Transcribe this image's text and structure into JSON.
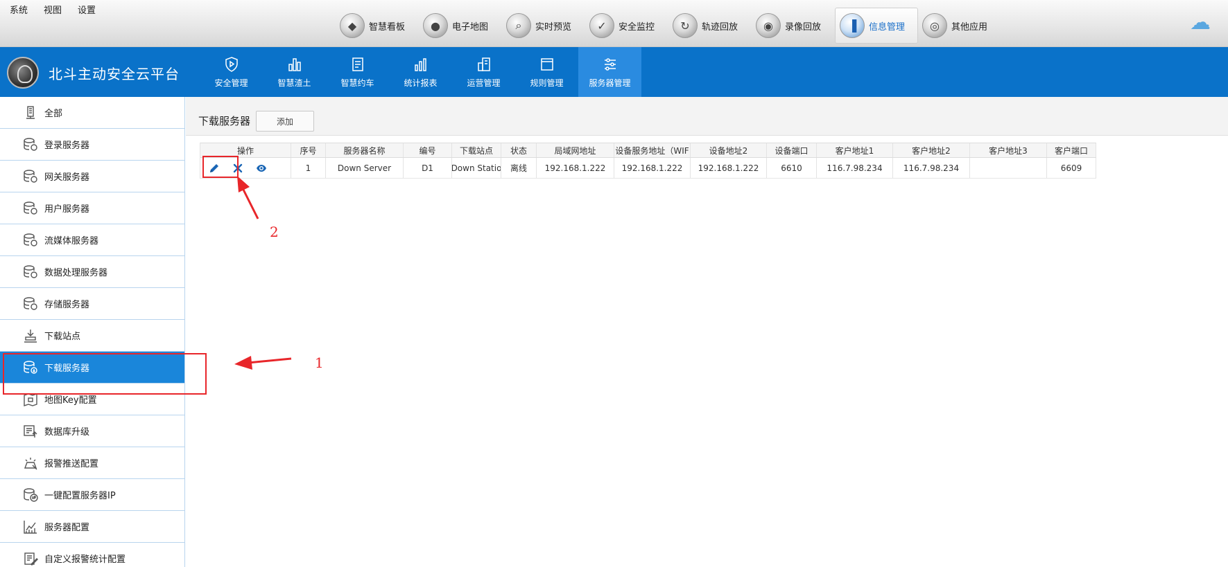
{
  "menubar": {
    "items": [
      "系统",
      "视图",
      "设置"
    ]
  },
  "modules": [
    {
      "label": "智慧看板",
      "icon": "shield-icon",
      "active": false
    },
    {
      "label": "电子地图",
      "icon": "map-pin-icon",
      "active": false
    },
    {
      "label": "实时预览",
      "icon": "magnifier-icon",
      "active": false
    },
    {
      "label": "安全监控",
      "icon": "shield-check-icon",
      "active": false
    },
    {
      "label": "轨迹回放",
      "icon": "track-icon",
      "active": false
    },
    {
      "label": "录像回放",
      "icon": "camera-icon",
      "active": false
    },
    {
      "label": "信息管理",
      "icon": "chart-icon",
      "active": true
    },
    {
      "label": "其他应用",
      "icon": "disc-icon",
      "active": false
    }
  ],
  "header": {
    "app_title": "北斗主动安全云平台",
    "nav": [
      {
        "label": "安全管理",
        "active": false
      },
      {
        "label": "智慧渣土",
        "active": false
      },
      {
        "label": "智慧约车",
        "active": false
      },
      {
        "label": "统计报表",
        "active": false
      },
      {
        "label": "运营管理",
        "active": false
      },
      {
        "label": "规则管理",
        "active": false
      },
      {
        "label": "服务器管理",
        "active": true
      }
    ]
  },
  "sidebar": {
    "items": [
      {
        "label": "全部",
        "active": false
      },
      {
        "label": "登录服务器",
        "active": false
      },
      {
        "label": "网关服务器",
        "active": false
      },
      {
        "label": "用户服务器",
        "active": false
      },
      {
        "label": "流媒体服务器",
        "active": false
      },
      {
        "label": "数据处理服务器",
        "active": false
      },
      {
        "label": "存储服务器",
        "active": false
      },
      {
        "label": "下载站点",
        "active": false
      },
      {
        "label": "下载服务器",
        "active": true
      },
      {
        "label": "地图Key配置",
        "active": false
      },
      {
        "label": "数据库升级",
        "active": false
      },
      {
        "label": "报警推送配置",
        "active": false
      },
      {
        "label": "一键配置服务器IP",
        "active": false
      },
      {
        "label": "服务器配置",
        "active": false
      },
      {
        "label": "自定义报警统计配置",
        "active": false
      }
    ]
  },
  "main": {
    "title": "下载服务器",
    "add_label": "添加",
    "columns": [
      "操作",
      "序号",
      "服务器名称",
      "编号",
      "下载站点",
      "状态",
      "局域网地址",
      "设备服务地址（WIF",
      "设备地址2",
      "设备端口",
      "客户地址1",
      "客户地址2",
      "客户地址3",
      "客户端口"
    ],
    "rows": [
      [
        "",
        "1",
        "Down Server",
        "D1",
        "Down Statio",
        "离线",
        "192.168.1.222",
        "192.168.1.222",
        "192.168.1.222",
        "6610",
        "116.7.98.234",
        "116.7.98.234",
        "",
        "6609"
      ]
    ]
  },
  "annotations": {
    "label_1": "1",
    "label_2": "2",
    "color": "#e8262a"
  },
  "colors": {
    "header_blue": "#0a72c9",
    "active_blue": "#1a86da",
    "link_blue": "#1a66b5"
  }
}
